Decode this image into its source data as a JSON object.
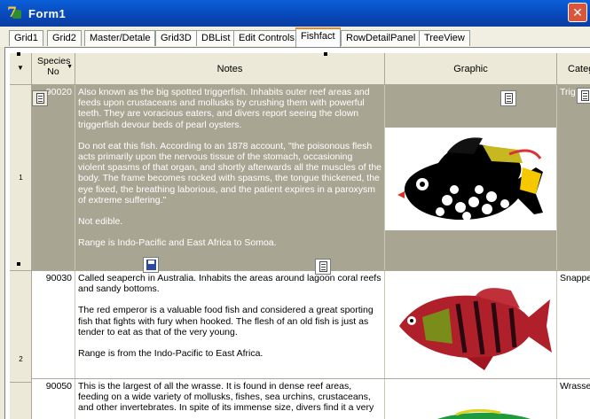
{
  "window": {
    "title": "Form1",
    "close_label": "✕"
  },
  "tabs": [
    {
      "label": "Grid1"
    },
    {
      "label": "Grid2"
    },
    {
      "label": "Master/Detale"
    },
    {
      "label": "Grid3D"
    },
    {
      "label": "DBList"
    },
    {
      "label": "Edit Controls"
    },
    {
      "label": "Fishfact",
      "active": true
    },
    {
      "label": "RowDetailPanel"
    },
    {
      "label": "TreeView"
    }
  ],
  "grid": {
    "columns": {
      "species_no": "Species No",
      "notes": "Notes",
      "graphic": "Graphic",
      "category": "Categ"
    },
    "rows": [
      {
        "row_number": "1",
        "species_no": "90020",
        "notes": [
          "Also known as the big spotted triggerfish.  Inhabits outer reef areas and feeds upon crustaceans and mollusks by crushing them with powerful teeth.  They are voracious eaters, and divers report seeing the clown triggerfish devour beds of pearl oysters.",
          "Do not eat this fish.  According to an 1878 account, \"the poisonous flesh acts primarily upon the nervous tissue of the stomach, occasioning violent spasms of that organ, and shortly afterwards all the muscles of the body.  The frame becomes rocked with spasms, the tongue thickened, the eye fixed, the breathing laborious, and the patient expires in a paroxysm of extreme suffering.\"",
          "Not edible.",
          "Range is Indo-Pacific and East Africa to Somoa."
        ],
        "category": "Trig",
        "selected": true
      },
      {
        "row_number": "2",
        "species_no": "90030",
        "notes": [
          "Called seaperch in Australia.  Inhabits the areas around lagoon coral reefs and sandy bottoms.",
          "The red emperor is a valuable food fish and considered a great sporting fish that fights with fury when hooked.  The flesh of an old fish is just as tender to eat as that of the very young.",
          "Range is from the Indo-Pacific to East Africa."
        ],
        "category": "Snapper"
      },
      {
        "row_number": "",
        "species_no": "90050",
        "notes": [
          "This is the largest of all the wrasse.  It is found in dense reef areas, feeding on a wide variety of mollusks, fishes, sea urchins, crustaceans, and other invertebrates. In spite of its immense size, divers find it a very"
        ],
        "category": "Wrasse"
      }
    ]
  },
  "colors": {
    "title_bar": "#0a4fc8",
    "tab_active_accent": "#e68b2c",
    "selected_row": "#a9a593",
    "header_bg": "#ece9d8"
  }
}
